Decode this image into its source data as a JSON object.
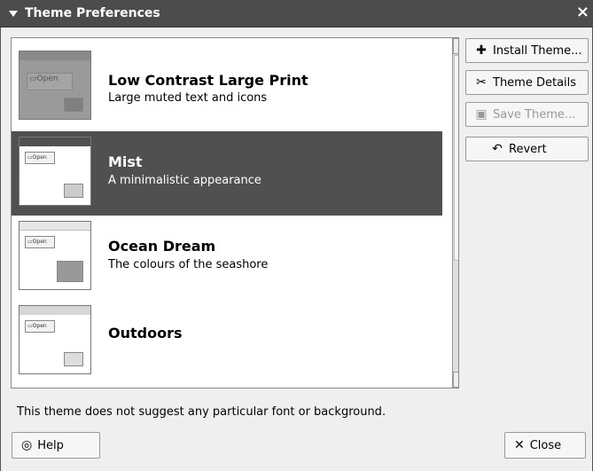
{
  "window": {
    "title": "Theme Preferences",
    "close_glyph": "×"
  },
  "themes": [
    {
      "name": "Low Contrast Large Print",
      "description": "Large muted text and icons",
      "selected": false,
      "thumb_open": "Open"
    },
    {
      "name": "Mist",
      "description": "A minimalistic appearance",
      "selected": true,
      "thumb_open": "Open"
    },
    {
      "name": "Ocean Dream",
      "description": "The colours of the seashore",
      "selected": false,
      "thumb_open": "Open"
    },
    {
      "name": "Outdoors",
      "description": "",
      "selected": false,
      "thumb_open": "Open"
    }
  ],
  "actions": {
    "install": "Install Theme...",
    "details": "Theme Details",
    "save": "Save Theme...",
    "revert": "Revert"
  },
  "status_text": "This theme does not suggest any particular font or background.",
  "buttons": {
    "help": "Help",
    "close": "Close"
  },
  "colors": {
    "selection": "#505050",
    "titlebar": "#4c4c4c"
  },
  "icons": {
    "install": "plus-icon",
    "details": "scissors-icon",
    "save": "save-icon",
    "revert": "undo-icon",
    "help": "lifebuoy-icon",
    "close": "close-icon"
  }
}
